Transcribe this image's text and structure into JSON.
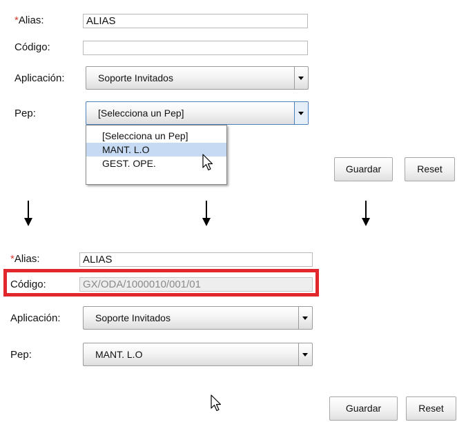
{
  "before": {
    "alias_label_star": "*",
    "alias_label": "Alias:",
    "alias_value": "ALIAS",
    "codigo_label": "Código:",
    "codigo_value": "",
    "aplicacion_label": "Aplicación:",
    "aplicacion_value": "Soporte Invitados",
    "pep_label": "Pep:",
    "pep_value": "[Selecciona un Pep]",
    "pep_options": [
      "[Selecciona un Pep]",
      "MANT. L.O",
      "GEST. OPE."
    ],
    "pep_highlighted_index": 1,
    "guardar_label": "Guardar",
    "reset_label": "Reset"
  },
  "after": {
    "alias_label_star": "*",
    "alias_label": "Alias:",
    "alias_value": "ALIAS",
    "codigo_label": "Código:",
    "codigo_value": "GX/ODA/1000010/001/01",
    "aplicacion_label": "Aplicación:",
    "aplicacion_value": "Soporte Invitados",
    "pep_label": "Pep:",
    "pep_value": "MANT. L.O",
    "guardar_label": "Guardar",
    "reset_label": "Reset"
  },
  "colors": {
    "required_star": "#d43b2e",
    "highlight_frame": "#e1262c",
    "option_highlight": "#c6daf3"
  },
  "icons": [
    "down-arrow-icon",
    "dropdown-caret-icon",
    "mouse-cursor-icon"
  ]
}
